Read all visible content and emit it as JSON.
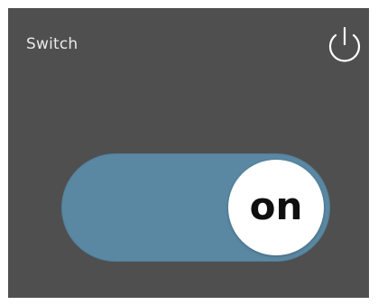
{
  "widget": {
    "title": "Switch",
    "power_icon": "power-icon",
    "toggle": {
      "state_label": "on",
      "is_on": true,
      "track_color": "#5a88a3",
      "knob_color": "#ffffff"
    },
    "card_color": "#4f4f4f",
    "text_color": "#e9e9e9"
  }
}
